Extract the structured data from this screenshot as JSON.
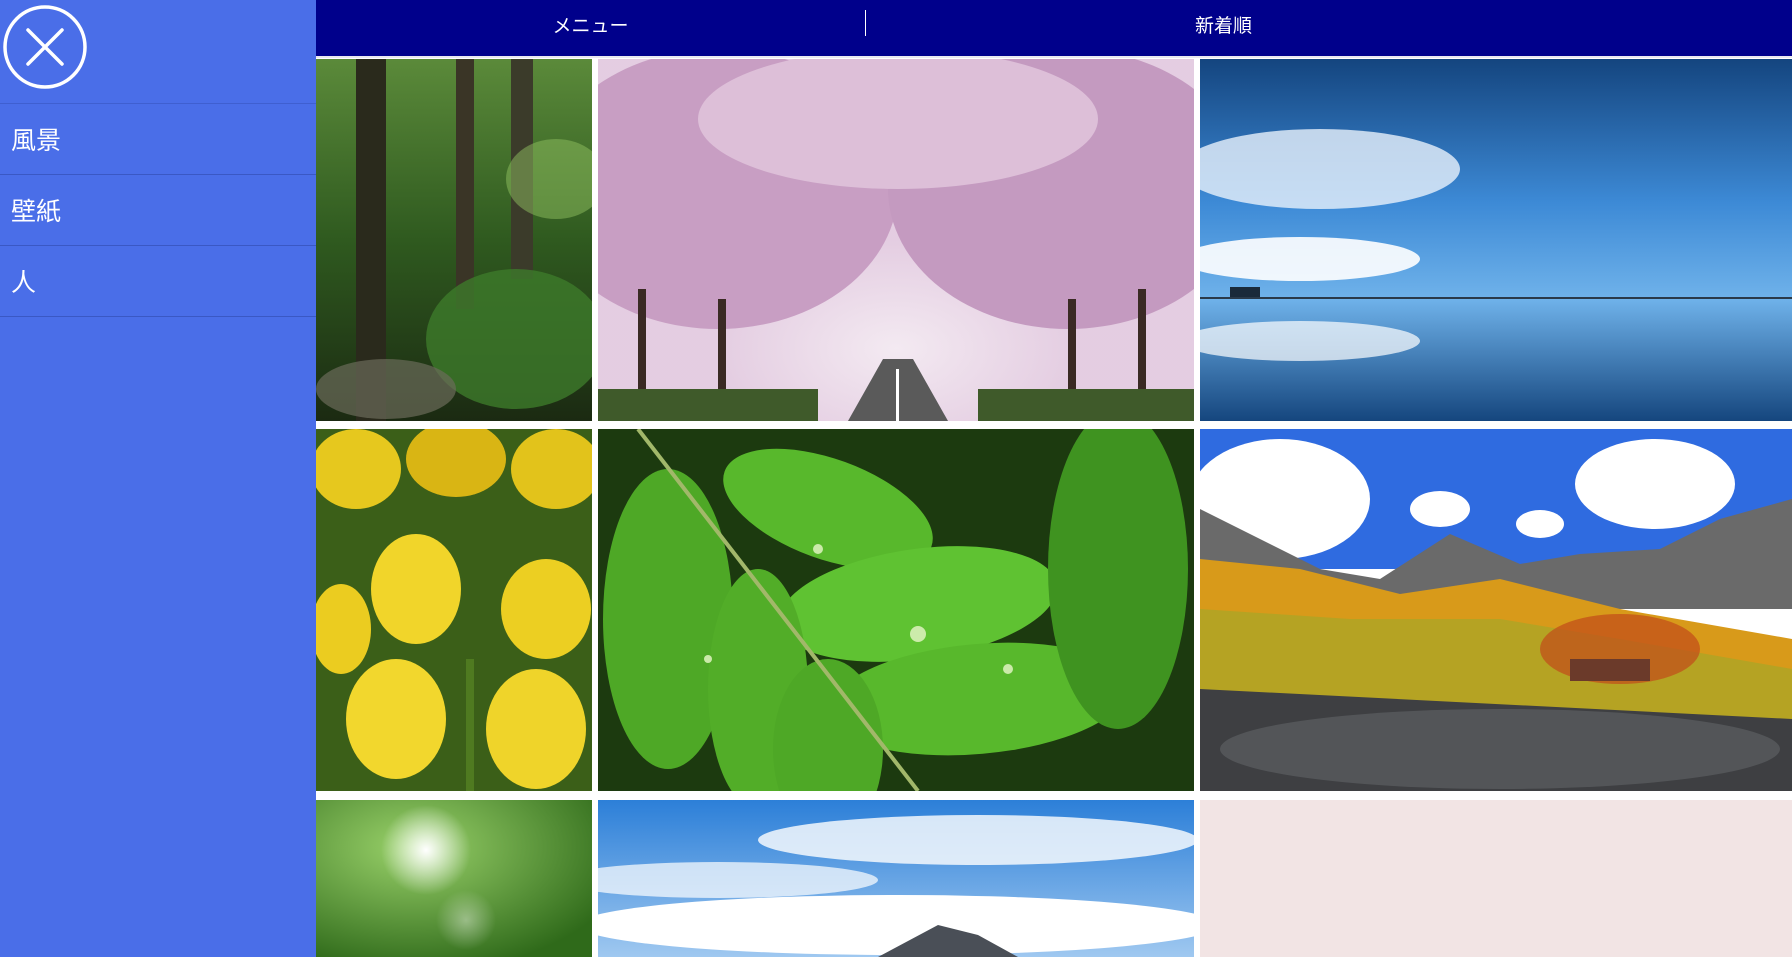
{
  "sidebar": {
    "close_icon": "close-icon",
    "items": [
      {
        "label": "風景"
      },
      {
        "label": "壁紙"
      },
      {
        "label": "人"
      }
    ]
  },
  "topbar": {
    "menu_label": "メニュー",
    "sort_label": "新着順"
  },
  "gallery": {
    "images": [
      {
        "subject": "forest"
      },
      {
        "subject": "cherry-blossom-road"
      },
      {
        "subject": "sky-reflection"
      },
      {
        "subject": "yellow-tulips"
      },
      {
        "subject": "green-leaf-droplets"
      },
      {
        "subject": "autumn-mountains"
      },
      {
        "subject": "green-bokeh"
      },
      {
        "subject": "mountain-above-clouds"
      },
      {
        "subject": "pale-pink-texture"
      }
    ]
  },
  "colors": {
    "sidebar": "#4a6ee8",
    "topbar": "#00008b"
  }
}
